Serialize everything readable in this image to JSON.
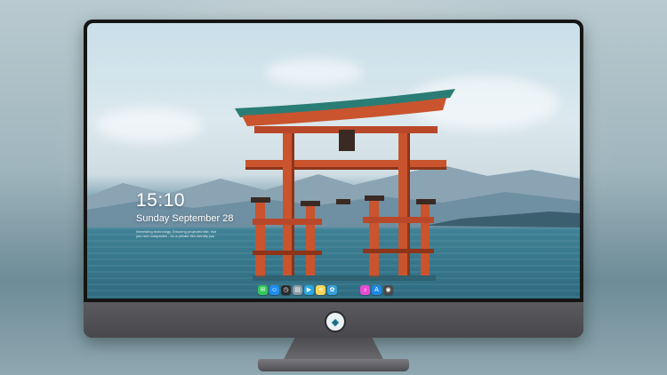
{
  "lock_screen": {
    "time": "15:10",
    "date": "Sunday September 28",
    "notice_line1": "Interesting technology. Ensuring projected title. Not",
    "notice_line2": "you rent companies - for a private film identify you"
  },
  "dock": {
    "icons": [
      {
        "name": "messages-icon",
        "glyph": "✉",
        "color": "#35c759"
      },
      {
        "name": "finder-icon",
        "glyph": "☺",
        "color": "#1f8ef1"
      },
      {
        "name": "clock-icon",
        "glyph": "◷",
        "color": "#2b2b2b"
      },
      {
        "name": "preview-icon",
        "glyph": "▤",
        "color": "#8a9aa5"
      },
      {
        "name": "claquette-icon",
        "glyph": "▶",
        "color": "#29a8e0"
      },
      {
        "name": "notes-icon",
        "glyph": "≡",
        "color": "#f6d55c"
      },
      {
        "name": "photos-icon",
        "glyph": "✿",
        "color": "#3aa0d8"
      },
      {
        "name": "music-icon",
        "glyph": "♪",
        "color": "#e84bd2"
      },
      {
        "name": "app-store-icon",
        "glyph": "A",
        "color": "#1e88e5"
      },
      {
        "name": "camera-icon",
        "glyph": "◉",
        "color": "#4a4a4a"
      }
    ]
  },
  "colors": {
    "torii": "#c9542e",
    "torii_dark": "#8e3419",
    "roof": "#2a7d74",
    "water": "#2f7489",
    "monitor_bezel": "#151515",
    "chin": "#505055"
  }
}
